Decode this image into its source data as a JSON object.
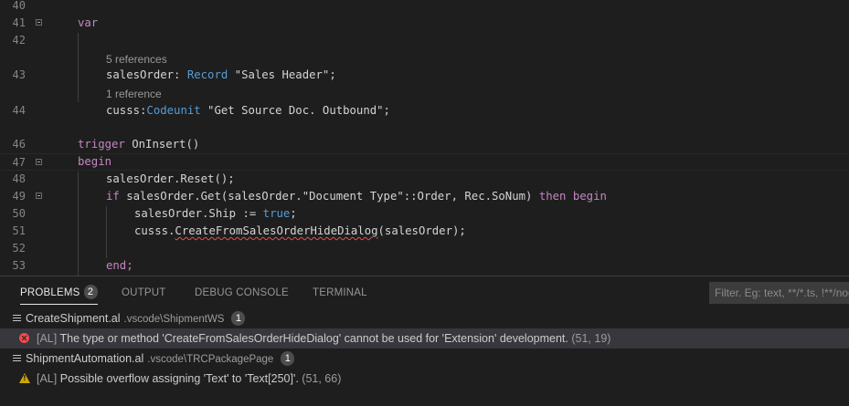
{
  "editor": {
    "lines": {
      "l40": "40",
      "l41": "41",
      "l42": "42",
      "l43": "43",
      "l44": "44",
      "l46": "46",
      "l47": "47",
      "l48": "48",
      "l49": "49",
      "l50": "50",
      "l51": "51",
      "l52": "52",
      "l53": "53"
    },
    "lens_sales": "5 references",
    "lens_cusss": "1 reference",
    "code": {
      "var_kw": "var",
      "sales_name": "salesOrder: ",
      "sales_type": "Record",
      "sales_rest": " \"Sales Header\";",
      "cusss_name": "cusss:",
      "cusss_type": "Codeunit",
      "cusss_rest": " \"Get Source Doc. Outbound\";",
      "trigger_kw": "trigger",
      "trigger_name": " OnInsert()",
      "begin_kw": "begin",
      "reset_line": "salesOrder.Reset();",
      "if_kw": "if",
      "if_mid": " salesOrder.Get(salesOrder.\"Document Type\"::Order, Rec.SoNum) ",
      "then_kw": "then",
      "begin2_kw": " begin",
      "ship_left": "salesOrder.Ship := ",
      "ship_true": "true",
      "ship_end": ";",
      "call_obj": "cusss.",
      "call_fn": "CreateFromSalesOrderHideDialog",
      "call_args": "(salesOrder);",
      "end_kw": "end;"
    }
  },
  "panel": {
    "tabs": {
      "problems": "PROBLEMS",
      "problems_count": "2",
      "output": "OUTPUT",
      "debug": "DEBUG CONSOLE",
      "terminal": "TERMINAL"
    },
    "filter_placeholder": "Filter. Eg: text, **/*.ts, !**/node_modules/**",
    "problems": [
      {
        "file": "CreateShipment.al",
        "path": ".vscode\\ShipmentWS",
        "count": "1",
        "source": "[AL]",
        "message": "The type or method 'CreateFromSalesOrderHideDialog' cannot be used for 'Extension' development.",
        "position": "(51, 19)",
        "severity": "error"
      },
      {
        "file": "ShipmentAutomation.al",
        "path": ".vscode\\TRCPackagePage",
        "count": "1",
        "source": "[AL]",
        "message": "Possible overflow assigning 'Text' to 'Text[250]'.",
        "position": "(51, 66)",
        "severity": "warning"
      }
    ]
  },
  "colors": {
    "background": "#1e1e1e",
    "keyword": "#c586c0",
    "type": "#569cd6",
    "error": "#f14c4c",
    "warning": "#cca700"
  }
}
